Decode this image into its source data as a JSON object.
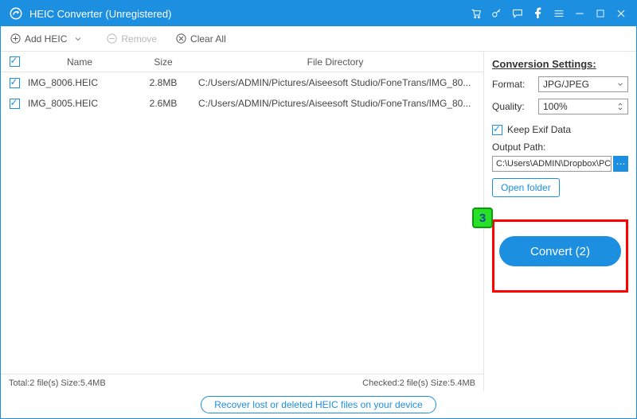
{
  "title": "HEIC Converter (Unregistered)",
  "toolbar": {
    "add_label": "Add HEIC",
    "remove_label": "Remove",
    "clear_label": "Clear All"
  },
  "columns": {
    "name": "Name",
    "size": "Size",
    "dir": "File Directory"
  },
  "files": [
    {
      "name": "IMG_8006.HEIC",
      "size": "2.8MB",
      "dir": "C:/Users/ADMIN/Pictures/Aiseesoft Studio/FoneTrans/IMG_80..."
    },
    {
      "name": "IMG_8005.HEIC",
      "size": "2.6MB",
      "dir": "C:/Users/ADMIN/Pictures/Aiseesoft Studio/FoneTrans/IMG_80..."
    }
  ],
  "status": {
    "total": "Total:2 file(s) Size:5.4MB",
    "checked": "Checked:2 file(s) Size:5.4MB"
  },
  "settings": {
    "heading": "Conversion Settings:",
    "format_label": "Format:",
    "format_value": "JPG/JPEG",
    "quality_label": "Quality:",
    "quality_value": "100%",
    "keep_exif_label": "Keep Exif Data",
    "output_path_label": "Output Path:",
    "output_path_value": "C:\\Users\\ADMIN\\Dropbox\\PC\\",
    "browse_label": "⋯",
    "open_folder_label": "Open folder",
    "convert_label": "Convert (2)"
  },
  "annotation": {
    "badge": "3"
  },
  "recover_label": "Recover lost or deleted HEIC files on your device"
}
